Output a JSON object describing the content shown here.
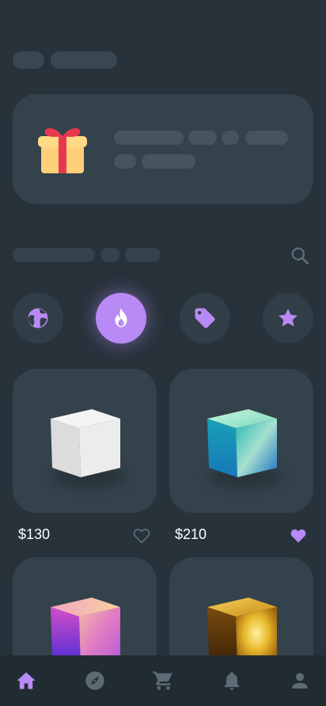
{
  "colors": {
    "background": "#27323a",
    "card": "#34424b",
    "accent": "#b88af5",
    "icon_muted": "#5d6b75",
    "nav_background": "#212b32"
  },
  "categories": [
    {
      "icon": "globe-icon",
      "active": false
    },
    {
      "icon": "fire-icon",
      "active": true
    },
    {
      "icon": "tag-icon",
      "active": false
    },
    {
      "icon": "star-icon",
      "active": false
    }
  ],
  "products": [
    {
      "price": "$130",
      "favorite": false,
      "cube": "white"
    },
    {
      "price": "$210",
      "favorite": true,
      "cube": "holographic-blue"
    },
    {
      "cube": "holographic-pink"
    },
    {
      "cube": "gold"
    }
  ],
  "nav": [
    {
      "icon": "home-icon",
      "active": true
    },
    {
      "icon": "compass-icon",
      "active": false
    },
    {
      "icon": "cart-icon",
      "active": false
    },
    {
      "icon": "bell-icon",
      "active": false
    },
    {
      "icon": "user-icon",
      "active": false
    }
  ]
}
